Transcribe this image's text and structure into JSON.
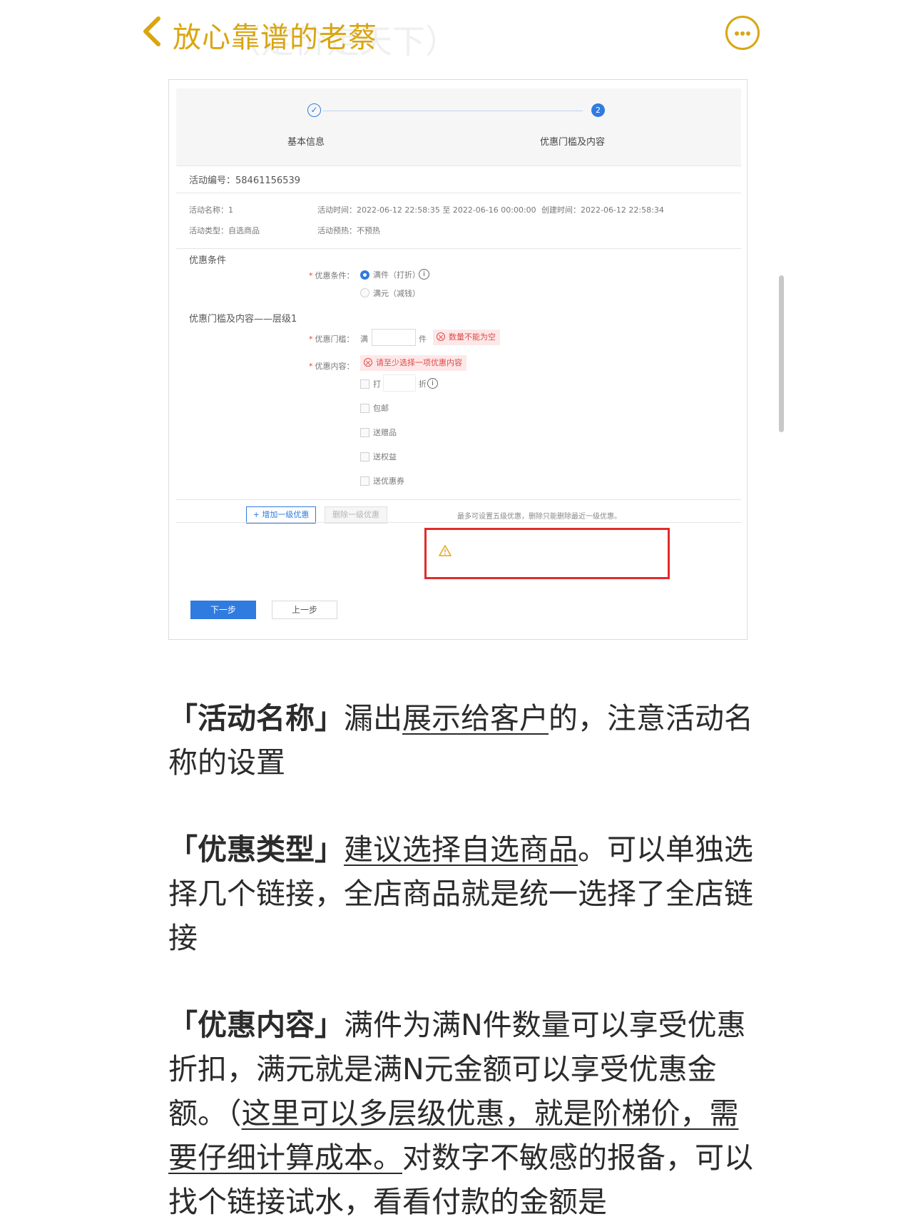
{
  "header": {
    "title": "放心靠谱的老蔡",
    "ghost_text": "（定价定天下）"
  },
  "screenshot": {
    "steps": {
      "step1_label": "基本信息",
      "step1_icon": "✓",
      "step2_label": "优惠门槛及内容",
      "step2_number": "2"
    },
    "activity_id": "活动编号：58461156539",
    "info": {
      "name": "活动名称：1",
      "time": "活动时间：2022-06-12 22:58:35 至 2022-06-16 00:00:00",
      "created": "创建时间：2022-06-12 22:58:34",
      "type": "活动类型：自选商品",
      "preheat": "活动预热：不预热"
    },
    "section_condition": "优惠条件",
    "condition_label": "优惠条件：",
    "option_full_piece": "满件（打折）",
    "option_full_yuan": "满元（减钱）",
    "section_threshold": "优惠门槛及内容——层级1",
    "threshold_label": "优惠门槛：",
    "threshold_prefix": "满",
    "threshold_unit": "件",
    "threshold_error": "数量不能为空",
    "content_label": "优惠内容：",
    "content_error": "请至少选择一项优惠内容",
    "discount_prefix": "打",
    "discount_suffix": "折",
    "options": [
      "包邮",
      "送赠品",
      "送权益",
      "送优惠券"
    ],
    "add_level_button": "+ 增加一级优惠",
    "delete_level_button": "删除一级优惠",
    "warning_text": "最多可设置五级优惠，删除只能删除最近一级优惠。",
    "next_button": "下一步",
    "prev_button": "上一步",
    "required_mark": "*",
    "info_icon": "i"
  },
  "article": {
    "p1": {
      "bold": "「活动名称」",
      "a": "漏出",
      "u": "展示给客户",
      "b": "的，注意活动名称的设置"
    },
    "p2": {
      "bold": "「优惠类型」",
      "u": "建议选择自选商品",
      "b": "。可以单独选择几个链接，全店商品就是统一选择了全店链接"
    },
    "p3": {
      "bold": "「优惠内容」",
      "a": "满件为满N件数量可以享受优惠折扣，满元就是满N元金额可以享受优惠金额。（",
      "u": "这里可以多层级优惠，就是阶梯价，需要仔细计算成本。",
      "b": "对数字不敏感的报备，可以找个链接试水，看看付款的金额是"
    }
  },
  "colors": {
    "accent": "#d9a612",
    "primary": "#2f7be0",
    "error": "#e04a4a",
    "highlight_box": "#e22b2b"
  }
}
